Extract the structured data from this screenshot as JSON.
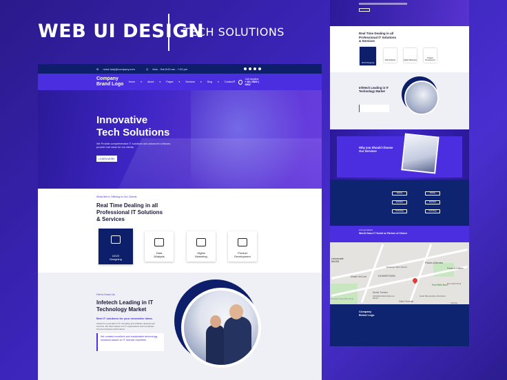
{
  "header": {
    "title": "WEB UI DESIGN",
    "subtitle": "TECH SOLUTIONS"
  },
  "topbar": {
    "email": "need-help@company.com",
    "hours": "Mon - Sat 8:00 am - 7:00 pm"
  },
  "nav": {
    "brand_line1": "Company",
    "brand_line2": "Brand Logo",
    "items": [
      "Home",
      "About",
      "Pages",
      "Services",
      "Blog",
      "Contact"
    ],
    "call_label": "Call Anytime",
    "call_number": "+ 88 ( 9800 ) 6802"
  },
  "hero": {
    "title_line1": "Innovative",
    "title_line2": "Tech Solutions",
    "body": "We Provide comprehensive IT solutions and advanced software, provide real value for our clients.",
    "cta": "LEARN MORE"
  },
  "services": {
    "eyebrow": "What We're Offering to Our Clients",
    "title_line1": "Real Time Dealing in all",
    "title_line2": "Professional IT Solutions",
    "title_line3": "& Services",
    "cards": [
      {
        "label1": "UI/UX",
        "label2": "Designing"
      },
      {
        "label1": "Data",
        "label2": "ANalysis"
      },
      {
        "label1": "Digital",
        "label2": "Marketing"
      },
      {
        "label1": "Product",
        "label2": "Development"
      }
    ]
  },
  "about": {
    "eyebrow": "Get to Know Us",
    "title_line1": "Infetech Leading in IT",
    "title_line2": "Technology Market",
    "lead": "Best IT solutions for your innovative ideas.",
    "body": "Infetech is a provider of IT consulting and software development services. We have helped non-IT organizations and companies improve business performance.",
    "quote": "We created excellent and sustainable technology solutions based on IT domain expertise."
  },
  "side": {
    "services_title_line1": "Real Time Dealing in all",
    "services_title_line2": "Professional IT Solutions",
    "services_title_line3": "& Services",
    "mini_cards": [
      "UI/UX Designing",
      "Data ANalysis",
      "Digital Marketing",
      "Product Development"
    ],
    "about_title_line1": "Infetech Leading in IT",
    "about_title_line2": "Technology Market",
    "why_title_line1": "Why you Should Choose",
    "why_title_line2": "Our Services",
    "tech_pills": [
      "Website",
      "Website",
      "Education",
      "Education",
      "Technology",
      "Technology"
    ],
    "partner_eyebrow": "Let's get started",
    "partner_title": "World Class IT Soluti ns Partner of Choice",
    "map_labels": [
      "Université McGill",
      "DOWNTOWN",
      "Place-d'Armes",
      "Basilique Saint-Patrick",
      "Musée McCord",
      "Monte Theater",
      "Cathédrale Marie-Reine-du-Monde",
      "Gare Centrale",
      "Hotel Bonaventure Montreal",
      "Pointe-à-Callière",
      "Parc Belle-Mont",
      "GOLDEN SQUARE MILE",
      "Victoria",
      "Rue Saint-Paul"
    ],
    "footer_brand_line1": "Company",
    "footer_brand_line2": "Brand Logo"
  }
}
